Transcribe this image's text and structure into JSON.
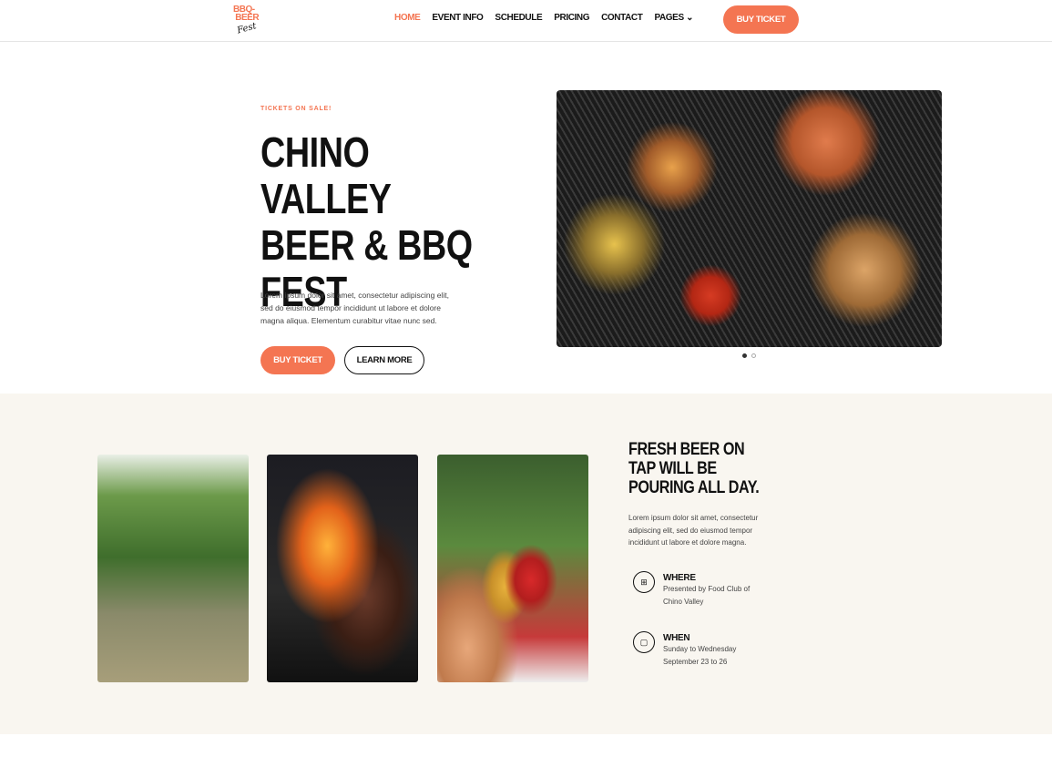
{
  "header": {
    "logo_text": "BBQ-BEER Fest",
    "nav": [
      {
        "label": "HOME",
        "active": true
      },
      {
        "label": "EVENT INFO"
      },
      {
        "label": "SCHEDULE"
      },
      {
        "label": "PRICING"
      },
      {
        "label": "CONTACT"
      },
      {
        "label": "PAGES"
      }
    ],
    "cta": "BUY TICKET"
  },
  "hero": {
    "eyebrow": "TICKETS ON SALE!",
    "title": "CHINO VALLEY BEER & BBQ FEST",
    "text": "Lorem ipsum dolor sit amet, consectetur adipiscing elit, sed do eiusmod tempor incididunt ut labore et dolore magna aliqua. Elementum curabitur vitae nunc sed.",
    "buy": "BUY TICKET",
    "learn": "LEARN MORE",
    "slide_count": 2,
    "active_slide": 1
  },
  "feature": {
    "title": "FRESH BEER ON TAP WILL BE POURING ALL DAY.",
    "text": "Lorem ipsum dolor sit amet, consectetur adipiscing elit, sed do eiusmod tempor incididunt ut labore et dolore magna.",
    "where": {
      "label": "WHERE",
      "text": "Presented by Food Club of Chino Valley",
      "icon": "map-icon"
    },
    "when": {
      "label": "WHEN",
      "text": "Sunday to Wednesday September 23 to 26",
      "icon": "calendar-icon"
    }
  },
  "colors": {
    "accent": "#f47552",
    "section_bg": "#f9f6f0"
  }
}
